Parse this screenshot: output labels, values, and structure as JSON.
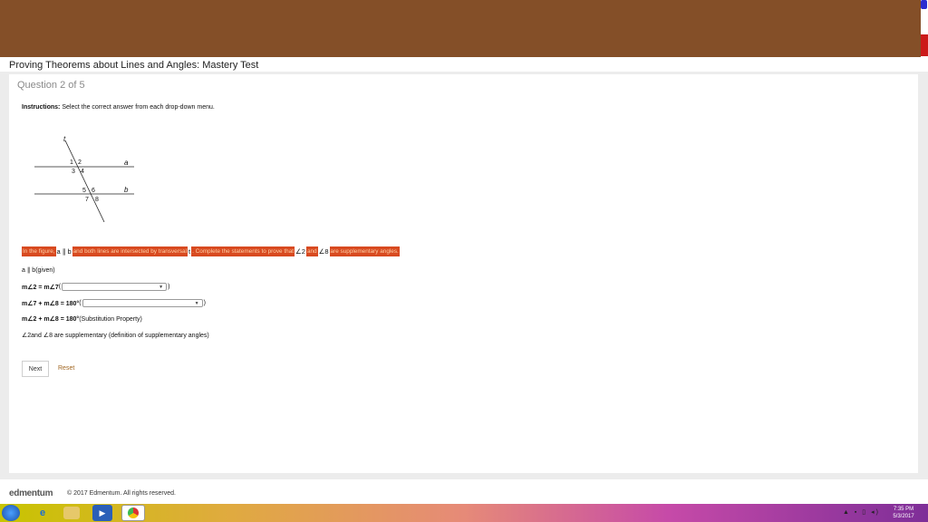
{
  "page": {
    "title": "Proving Theorems about Lines and Angles: Mastery Test",
    "question_counter": "Question 2 of 5"
  },
  "instructions": {
    "label": "Instructions:",
    "text": "Select the correct answer from each drop-down menu."
  },
  "figure": {
    "labels": {
      "t": "t",
      "a": "a",
      "b": "b",
      "n1": "1",
      "n2": "2",
      "n3": "3",
      "n4": "4",
      "n5": "5",
      "n6": "6",
      "n7": "7",
      "n8": "8"
    }
  },
  "prompt": {
    "p1": "In the figure,",
    "a": "a",
    "parallel": "∥",
    "b": "b",
    "p2": "and both lines are intersected by transversal",
    "t": "t",
    "p3": ". Complete the statements to prove that",
    "ang2": "∠2",
    "and": "and",
    "ang8": "∠8",
    "p4": "are supplementary angles."
  },
  "statements": {
    "s1_expr": "a ∥ b",
    "s1_reason": "(given)",
    "s2_expr": "m∠2 = m∠7",
    "s3_expr": "m∠7 + m∠8 = 180°",
    "s4_expr": "m∠2 + m∠8 = 180°",
    "s4_reason": "(Substitution Property)",
    "s5_expr": "∠2and ∠8 are supplementary",
    "s5_reason": "(definition of supplementary angles)",
    "paren_open": "(",
    "paren_close": ")",
    "dropdown_caret": "▼"
  },
  "buttons": {
    "next": "Next",
    "reset": "Reset"
  },
  "footer": {
    "logo": "edmentum",
    "copyright": "© 2017 Edmentum. All rights reserved."
  },
  "taskbar": {
    "tray_icons": "▲ ▪ ▯ ◂)",
    "time": "7:35 PM",
    "date": "5/3/2017"
  },
  "colors": {
    "header": "#844f28",
    "highlight": "#d84a20",
    "reset_link": "#a06520"
  }
}
